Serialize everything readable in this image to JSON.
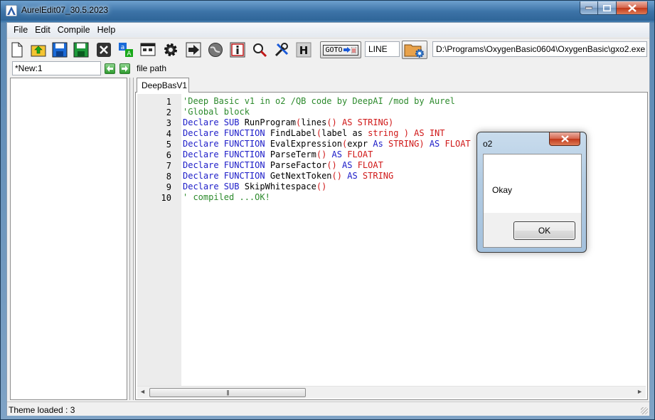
{
  "window": {
    "title": "AurelEdit07_30.5.2023"
  },
  "menu": [
    "File",
    "Edit",
    "Compile",
    "Help"
  ],
  "toolbar": {
    "goto_label": "GOTO",
    "line_value": "LINE",
    "compiler_path": "D:\\Programs\\OxygenBasic0604\\OxygenBasic\\gxo2.exe"
  },
  "file_row": {
    "file_name": "*New:1",
    "file_path_label": "file path"
  },
  "tabs": [
    {
      "label": "DeepBasV1"
    }
  ],
  "editor": {
    "line_numbers": [
      "1",
      "2",
      "3",
      "4",
      "5",
      "6",
      "7",
      "8",
      "9",
      "10"
    ]
  },
  "status": {
    "text": "Theme loaded : 3"
  },
  "dialog": {
    "title": "o2",
    "message": "Okay",
    "ok_label": "OK"
  },
  "colors": {
    "comment": "#2c8a2c",
    "keyword": "#1c1cc8",
    "type": "#d01818"
  }
}
